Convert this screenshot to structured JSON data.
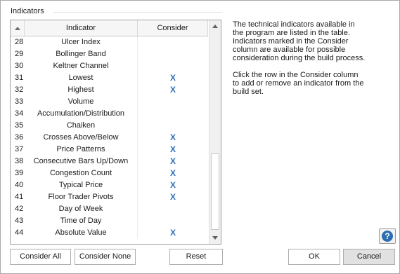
{
  "group": {
    "title": "Indicators"
  },
  "table": {
    "headers": {
      "indicator": "Indicator",
      "consider": "Consider"
    },
    "rows": [
      {
        "num": "28",
        "name": "Ulcer Index",
        "consider": ""
      },
      {
        "num": "29",
        "name": "Bollinger Band",
        "consider": ""
      },
      {
        "num": "30",
        "name": "Keltner Channel",
        "consider": ""
      },
      {
        "num": "31",
        "name": "Lowest",
        "consider": "X"
      },
      {
        "num": "32",
        "name": "Highest",
        "consider": "X"
      },
      {
        "num": "33",
        "name": "Volume",
        "consider": ""
      },
      {
        "num": "34",
        "name": "Accumulation/Distribution",
        "consider": ""
      },
      {
        "num": "35",
        "name": "Chaiken",
        "consider": ""
      },
      {
        "num": "36",
        "name": "Crosses Above/Below",
        "consider": "X"
      },
      {
        "num": "37",
        "name": "Price Patterns",
        "consider": "X"
      },
      {
        "num": "38",
        "name": "Consecutive Bars Up/Down",
        "consider": "X"
      },
      {
        "num": "39",
        "name": "Congestion Count",
        "consider": "X"
      },
      {
        "num": "40",
        "name": "Typical Price",
        "consider": "X"
      },
      {
        "num": "41",
        "name": "Floor Trader Pivots",
        "consider": "X"
      },
      {
        "num": "42",
        "name": "Day of Week",
        "consider": ""
      },
      {
        "num": "43",
        "name": "Time of Day",
        "consider": ""
      },
      {
        "num": "44",
        "name": "Absolute Value",
        "consider": "X"
      }
    ]
  },
  "description": {
    "para1": "The technical indicators available in the program are listed in the table. Indicators marked in the Consider column are available for possible consideration during the build process.",
    "para2": "Click the row in the Consider column to add or remove an indicator from the build set."
  },
  "buttons": {
    "consider_all": "Consider All",
    "consider_none": "Consider None",
    "reset": "Reset",
    "ok": "OK",
    "cancel": "Cancel",
    "help": "?"
  },
  "colors": {
    "accent": "#2f6fb6",
    "help": "#2c6eb0"
  }
}
